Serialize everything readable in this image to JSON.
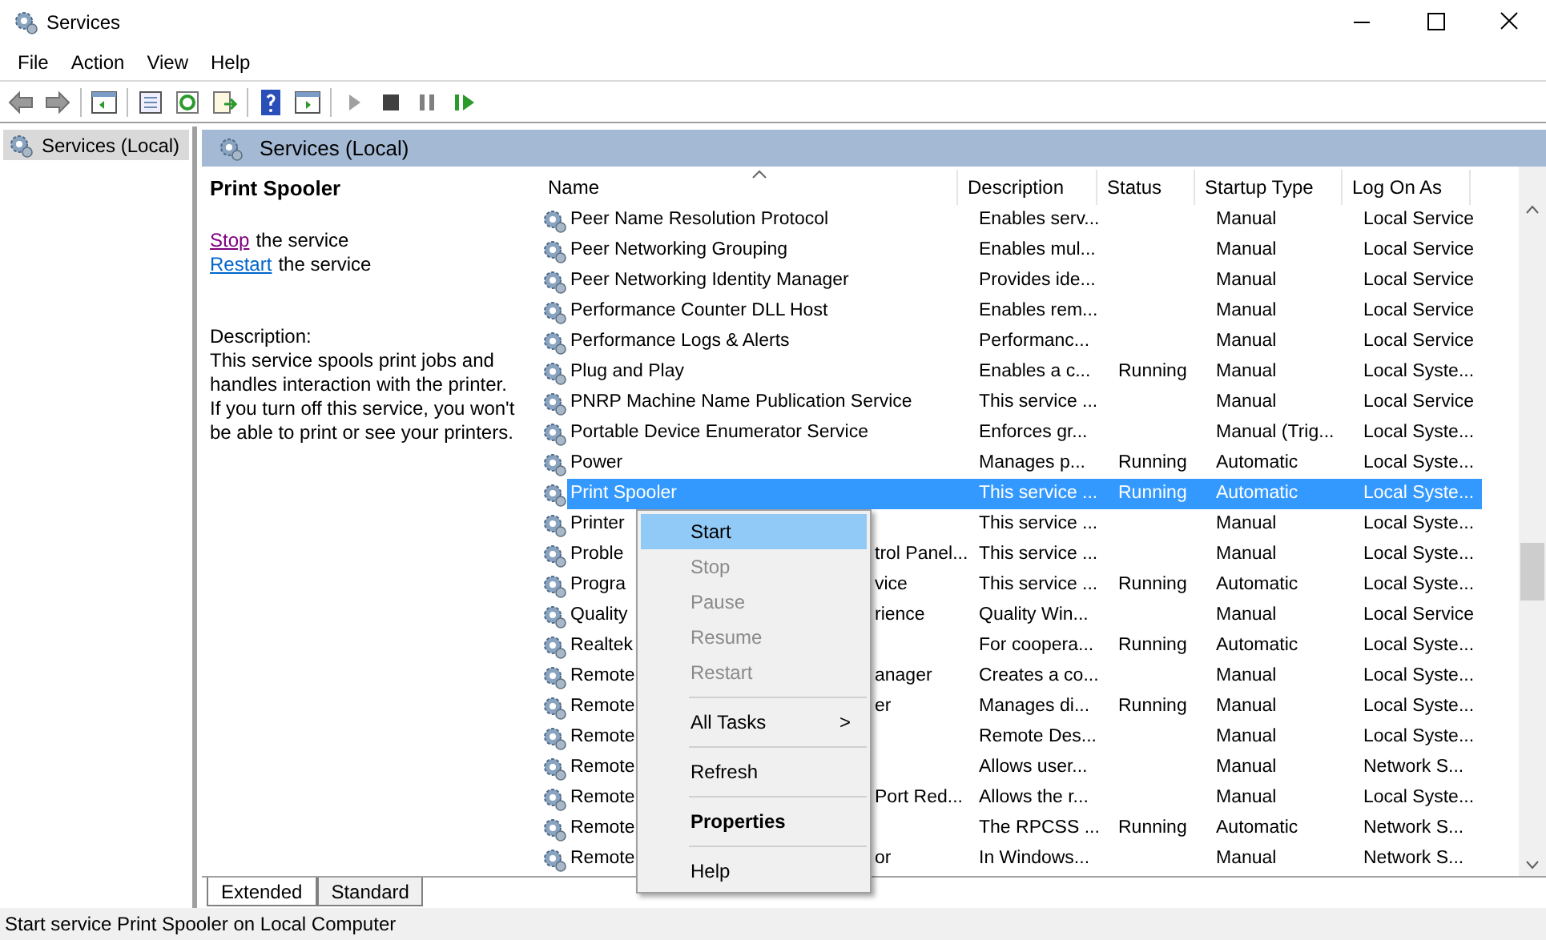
{
  "window": {
    "title": "Services"
  },
  "menu": [
    "File",
    "Action",
    "View",
    "Help"
  ],
  "tree": [
    {
      "label": "Services (Local)",
      "selected": true
    }
  ],
  "pane_title": "Services (Local)",
  "detail": {
    "title": "Print Spooler",
    "actions": [
      {
        "link": "Stop",
        "text": "the service",
        "visited": true
      },
      {
        "link": "Restart",
        "text": "the service",
        "visited": false
      }
    ],
    "description_label": "Description:",
    "description": "This service spools print jobs and handles interaction with the printer. If you turn off this service, you won't be able to print or see your printers."
  },
  "table": {
    "columns": [
      "Name",
      "Description",
      "Status",
      "Startup Type",
      "Log On As"
    ],
    "rows": [
      {
        "name": "Peer Name Resolution Protocol",
        "description": "Enables serv...",
        "status": "",
        "startup": "Manual",
        "logon": "Local Service",
        "selected": false
      },
      {
        "name": "Peer Networking Grouping",
        "description": "Enables mul...",
        "status": "",
        "startup": "Manual",
        "logon": "Local Service",
        "selected": false
      },
      {
        "name": "Peer Networking Identity Manager",
        "description": "Provides ide...",
        "status": "",
        "startup": "Manual",
        "logon": "Local Service",
        "selected": false
      },
      {
        "name": "Performance Counter DLL Host",
        "description": "Enables rem...",
        "status": "",
        "startup": "Manual",
        "logon": "Local Service",
        "selected": false
      },
      {
        "name": "Performance Logs & Alerts",
        "description": "Performanc...",
        "status": "",
        "startup": "Manual",
        "logon": "Local Service",
        "selected": false
      },
      {
        "name": "Plug and Play",
        "description": "Enables a c...",
        "status": "Running",
        "startup": "Manual",
        "logon": "Local Syste...",
        "selected": false
      },
      {
        "name": "PNRP Machine Name Publication Service",
        "description": "This service ...",
        "status": "",
        "startup": "Manual",
        "logon": "Local Service",
        "selected": false
      },
      {
        "name": "Portable Device Enumerator Service",
        "description": "Enforces gr...",
        "status": "",
        "startup": "Manual (Trig...",
        "logon": "Local Syste...",
        "selected": false
      },
      {
        "name": "Power",
        "description": "Manages p...",
        "status": "Running",
        "startup": "Automatic",
        "logon": "Local Syste...",
        "selected": false
      },
      {
        "name": "Print Spooler",
        "description": "This service ...",
        "status": "Running",
        "startup": "Automatic",
        "logon": "Local Syste...",
        "selected": true
      },
      {
        "name": "Printer",
        "description": "This service ...",
        "status": "",
        "startup": "Manual",
        "logon": "Local Syste...",
        "selected": false
      },
      {
        "name": "Proble",
        "name_tail": "trol Panel...",
        "description": "This service ...",
        "status": "",
        "startup": "Manual",
        "logon": "Local Syste...",
        "selected": false
      },
      {
        "name": "Progra",
        "name_tail": "vice",
        "description": "This service ...",
        "status": "Running",
        "startup": "Automatic",
        "logon": "Local Syste...",
        "selected": false
      },
      {
        "name": "Quality",
        "name_tail": "rience",
        "description": "Quality Win...",
        "status": "",
        "startup": "Manual",
        "logon": "Local Service",
        "selected": false
      },
      {
        "name": "Realtek",
        "description": "For coopera...",
        "status": "Running",
        "startup": "Automatic",
        "logon": "Local Syste...",
        "selected": false
      },
      {
        "name": "Remote",
        "name_tail": "anager",
        "description": "Creates a co...",
        "status": "",
        "startup": "Manual",
        "logon": "Local Syste...",
        "selected": false
      },
      {
        "name": "Remote",
        "name_tail": "er",
        "description": "Manages di...",
        "status": "Running",
        "startup": "Manual",
        "logon": "Local Syste...",
        "selected": false
      },
      {
        "name": "Remote",
        "description": "Remote Des...",
        "status": "",
        "startup": "Manual",
        "logon": "Local Syste...",
        "selected": false
      },
      {
        "name": "Remote",
        "description": "Allows user...",
        "status": "",
        "startup": "Manual",
        "logon": "Network S...",
        "selected": false
      },
      {
        "name": "Remote",
        "name_tail": "Port Red...",
        "description": "Allows the r...",
        "status": "",
        "startup": "Manual",
        "logon": "Local Syste...",
        "selected": false
      },
      {
        "name": "Remote",
        "description": "The RPCSS ...",
        "status": "Running",
        "startup": "Automatic",
        "logon": "Network S...",
        "selected": false
      },
      {
        "name": "Remote",
        "name_tail": "or",
        "description": "In Windows...",
        "status": "",
        "startup": "Manual",
        "logon": "Network S...",
        "selected": false
      }
    ]
  },
  "context_menu": [
    {
      "kind": "item",
      "label": "Start",
      "selected": true,
      "disabled": false
    },
    {
      "kind": "item",
      "label": "Stop",
      "selected": false,
      "disabled": true
    },
    {
      "kind": "item",
      "label": "Pause",
      "selected": false,
      "disabled": true
    },
    {
      "kind": "item",
      "label": "Resume",
      "selected": false,
      "disabled": true
    },
    {
      "kind": "item",
      "label": "Restart",
      "selected": false,
      "disabled": true
    },
    {
      "kind": "separator"
    },
    {
      "kind": "submenu",
      "label": "All Tasks",
      "arrow": ">",
      "selected": false,
      "disabled": false
    },
    {
      "kind": "separator"
    },
    {
      "kind": "item",
      "label": "Refresh",
      "selected": false,
      "disabled": false
    },
    {
      "kind": "separator"
    },
    {
      "kind": "default",
      "label": "Properties",
      "selected": false,
      "disabled": false
    },
    {
      "kind": "separator"
    },
    {
      "kind": "item",
      "label": "Help",
      "selected": false,
      "disabled": false
    }
  ],
  "tabs": [
    {
      "label": "Extended",
      "selected": true
    },
    {
      "label": "Standard",
      "selected": false
    }
  ],
  "status_bar": "Start service Print Spooler on Local Computer"
}
